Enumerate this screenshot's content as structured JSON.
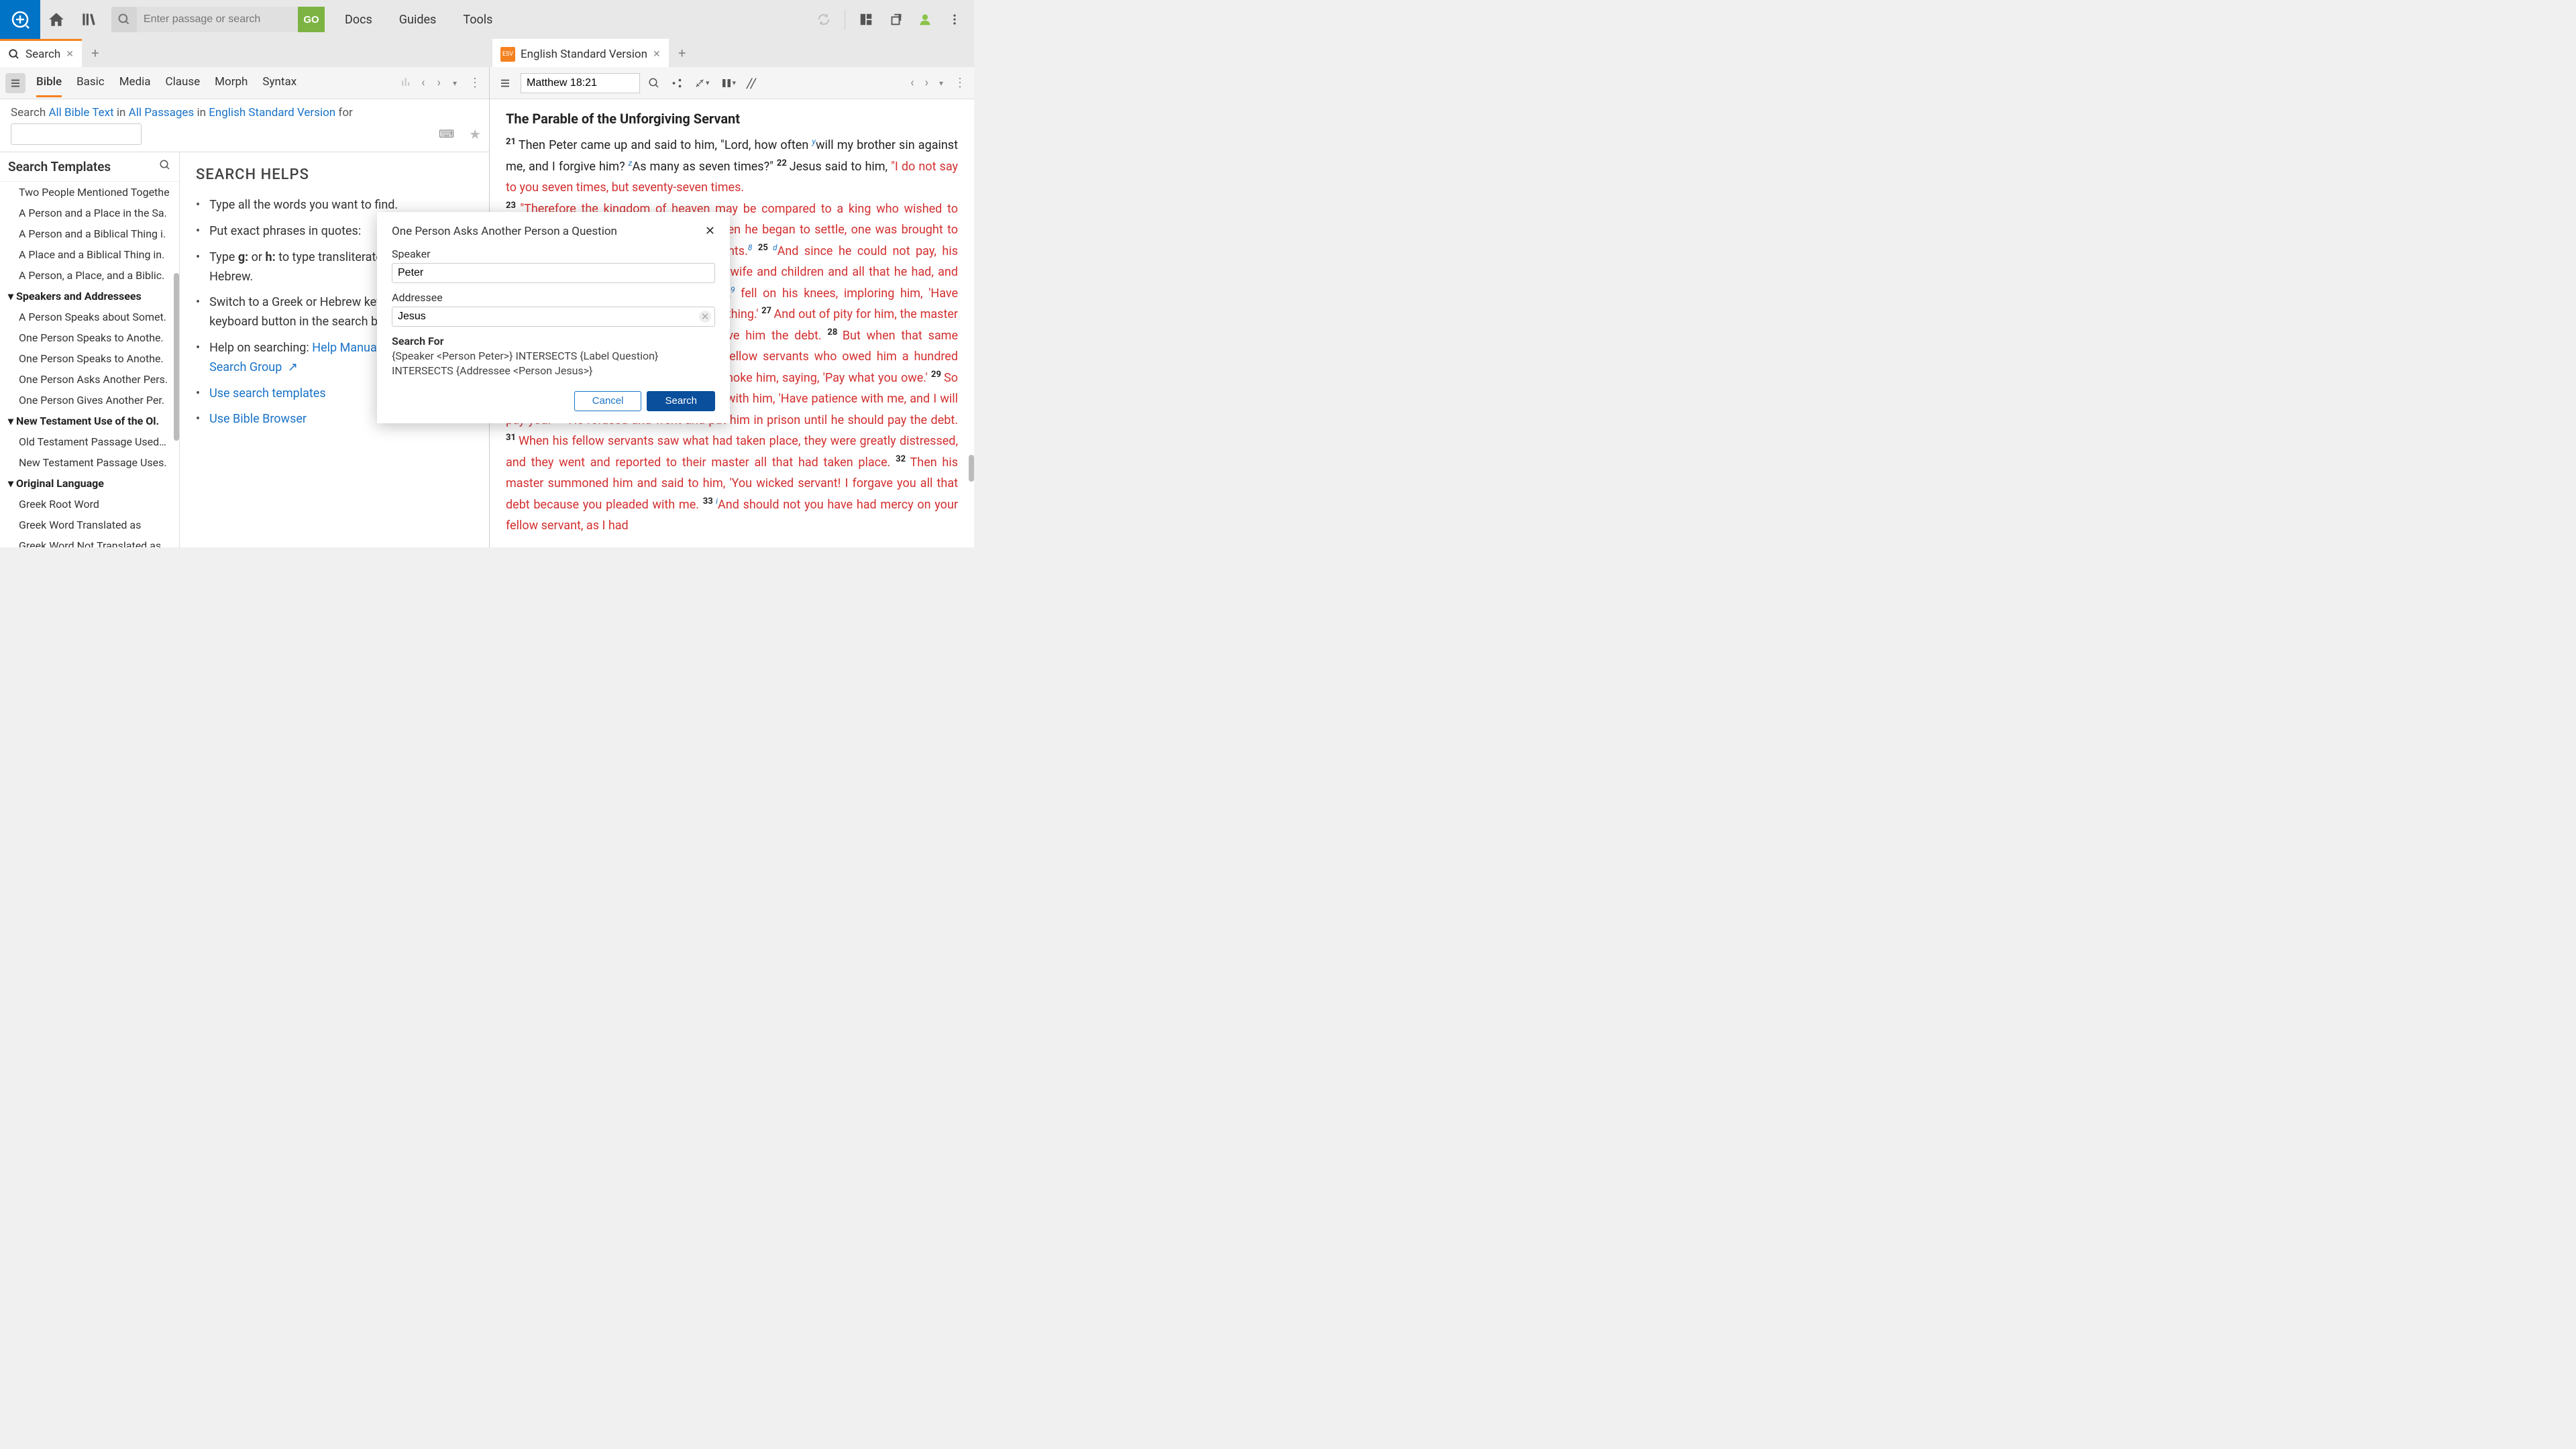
{
  "top": {
    "search_placeholder": "Enter passage or search",
    "go": "GO",
    "menu": [
      "Docs",
      "Guides",
      "Tools"
    ]
  },
  "tabs": {
    "search": "Search",
    "esv": "English Standard Version"
  },
  "search_pane": {
    "subtabs": [
      "Bible",
      "Basic",
      "Media",
      "Clause",
      "Morph",
      "Syntax"
    ],
    "scope": {
      "prefix": "Search",
      "text": "All Bible Text",
      "in1": "in",
      "passages": "All Passages",
      "in2": "in",
      "version": "English Standard Version",
      "for": "for"
    },
    "templates_header": "Search Templates",
    "templates": [
      {
        "t": "item",
        "label": "Two People Mentioned Togethe"
      },
      {
        "t": "item",
        "label": "A Person and a Place in the Sa."
      },
      {
        "t": "item",
        "label": "A Person and a Biblical Thing i."
      },
      {
        "t": "item",
        "label": "A Place and a Biblical Thing in."
      },
      {
        "t": "item",
        "label": "A Person, a Place, and a Biblic."
      },
      {
        "t": "group",
        "label": "Speakers and Addressees"
      },
      {
        "t": "item",
        "label": "A Person Speaks about Somet."
      },
      {
        "t": "item",
        "label": "One Person Speaks to Anothe."
      },
      {
        "t": "item",
        "label": "One Person Speaks to Anothe."
      },
      {
        "t": "item",
        "label": "One Person Asks Another Pers."
      },
      {
        "t": "item",
        "label": "One Person Gives Another Per."
      },
      {
        "t": "group",
        "label": "New Testament Use of the Ol."
      },
      {
        "t": "item",
        "label": "Old Testament Passage Used…"
      },
      {
        "t": "item",
        "label": "New Testament Passage Uses."
      },
      {
        "t": "group",
        "label": "Original Language"
      },
      {
        "t": "item",
        "label": "Greek Root Word"
      },
      {
        "t": "item",
        "label": "Greek Word Translated as"
      },
      {
        "t": "item",
        "label": "Greek Word Not Translated as"
      }
    ],
    "helps_title": "SEARCH HELPS",
    "helps": [
      {
        "text": "Type all the words you want to find."
      },
      {
        "text": "Put exact phrases in quotes:"
      },
      {
        "html": "Type <b>g:</b> or <b>h:</b> to type transliterated Greek or Hebrew."
      },
      {
        "text": "Switch to a Greek or Hebrew keyboard with the keyboard button in the search box."
      },
      {
        "html": "Help on searching: <a>Help Manual...</a> <a>Customer Search Group</a> <span class='ext-icon'>↗</span>"
      },
      {
        "html": "<a>Use search templates</a>"
      },
      {
        "html": "<a>Use Bible Browser</a>"
      }
    ]
  },
  "bible": {
    "ref": "Matthew 18:21",
    "heading": "The Parable of the Unforgiving Servant"
  },
  "modal": {
    "title": "One Person Asks Another Person a Question",
    "speaker_label": "Speaker",
    "speaker_value": "Peter",
    "addressee_label": "Addressee",
    "addressee_value": "Jesus",
    "search_for_label": "Search For",
    "query": "{Speaker <Person Peter>} INTERSECTS {Label Question} INTERSECTS {Addressee <Person Jesus>}",
    "cancel": "Cancel",
    "search": "Search"
  }
}
